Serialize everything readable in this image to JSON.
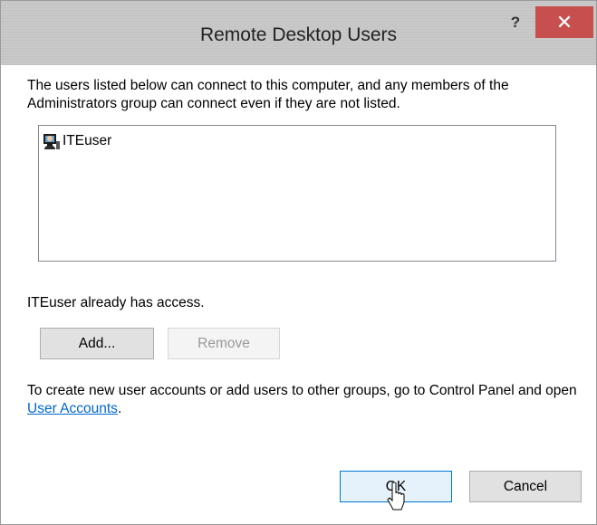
{
  "window": {
    "title": "Remote Desktop Users",
    "help_label": "?",
    "close_label": "✕"
  },
  "description": "The users listed below can connect to this computer, and any members of the Administrators group can connect even if they are not listed.",
  "users": [
    {
      "name": "ITEuser",
      "icon": "user-icon"
    }
  ],
  "status": "ITEuser already has access.",
  "buttons": {
    "add": "Add...",
    "remove": "Remove",
    "ok": "OK",
    "cancel": "Cancel"
  },
  "info": {
    "before": "To create new user accounts or add users to other groups, go to Control Panel and open ",
    "link": "User Accounts",
    "after": "."
  },
  "colors": {
    "close_button": "#c7504f",
    "link": "#0066cc",
    "focus_border": "#0078d7"
  }
}
